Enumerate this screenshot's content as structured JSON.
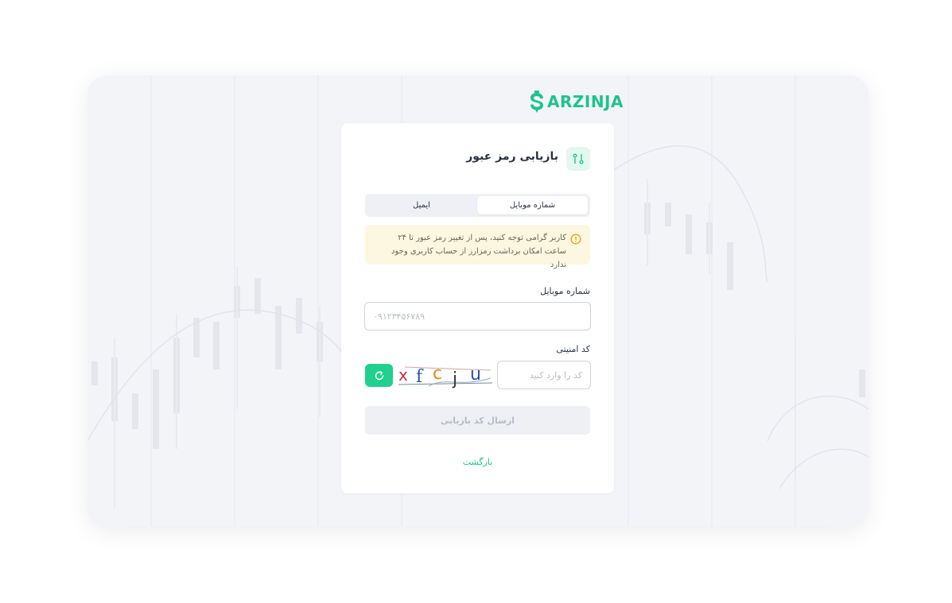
{
  "brand": {
    "name": "ARZINJA",
    "accent": "#1fc38c"
  },
  "card": {
    "title": "بازیابی رمز عبور",
    "header_icon": "sliders-icon"
  },
  "tabs": [
    {
      "label": "شماره موبایل",
      "active": true
    },
    {
      "label": "ایمیل",
      "active": false
    }
  ],
  "notice": {
    "icon": "warning-icon",
    "text": "کاربر گرامی توجه کنید، پس از تغییر رمز عبور تا ۲۴ ساعت امکان برداشت رمزارز از حساب کاربری وجود ندارد"
  },
  "mobile_field": {
    "label": "شماره موبایل",
    "placeholder": "۰۹۱۲۳۴۵۶۷۸۹",
    "value": ""
  },
  "captcha_field": {
    "label": "کد امنیتی",
    "placeholder": "کد را وارد کنید",
    "value": "",
    "refresh_icon": "refresh-icon"
  },
  "submit_button": {
    "label": "ارسال کد بازیابی"
  },
  "back_link": {
    "label": "بازگشت"
  }
}
